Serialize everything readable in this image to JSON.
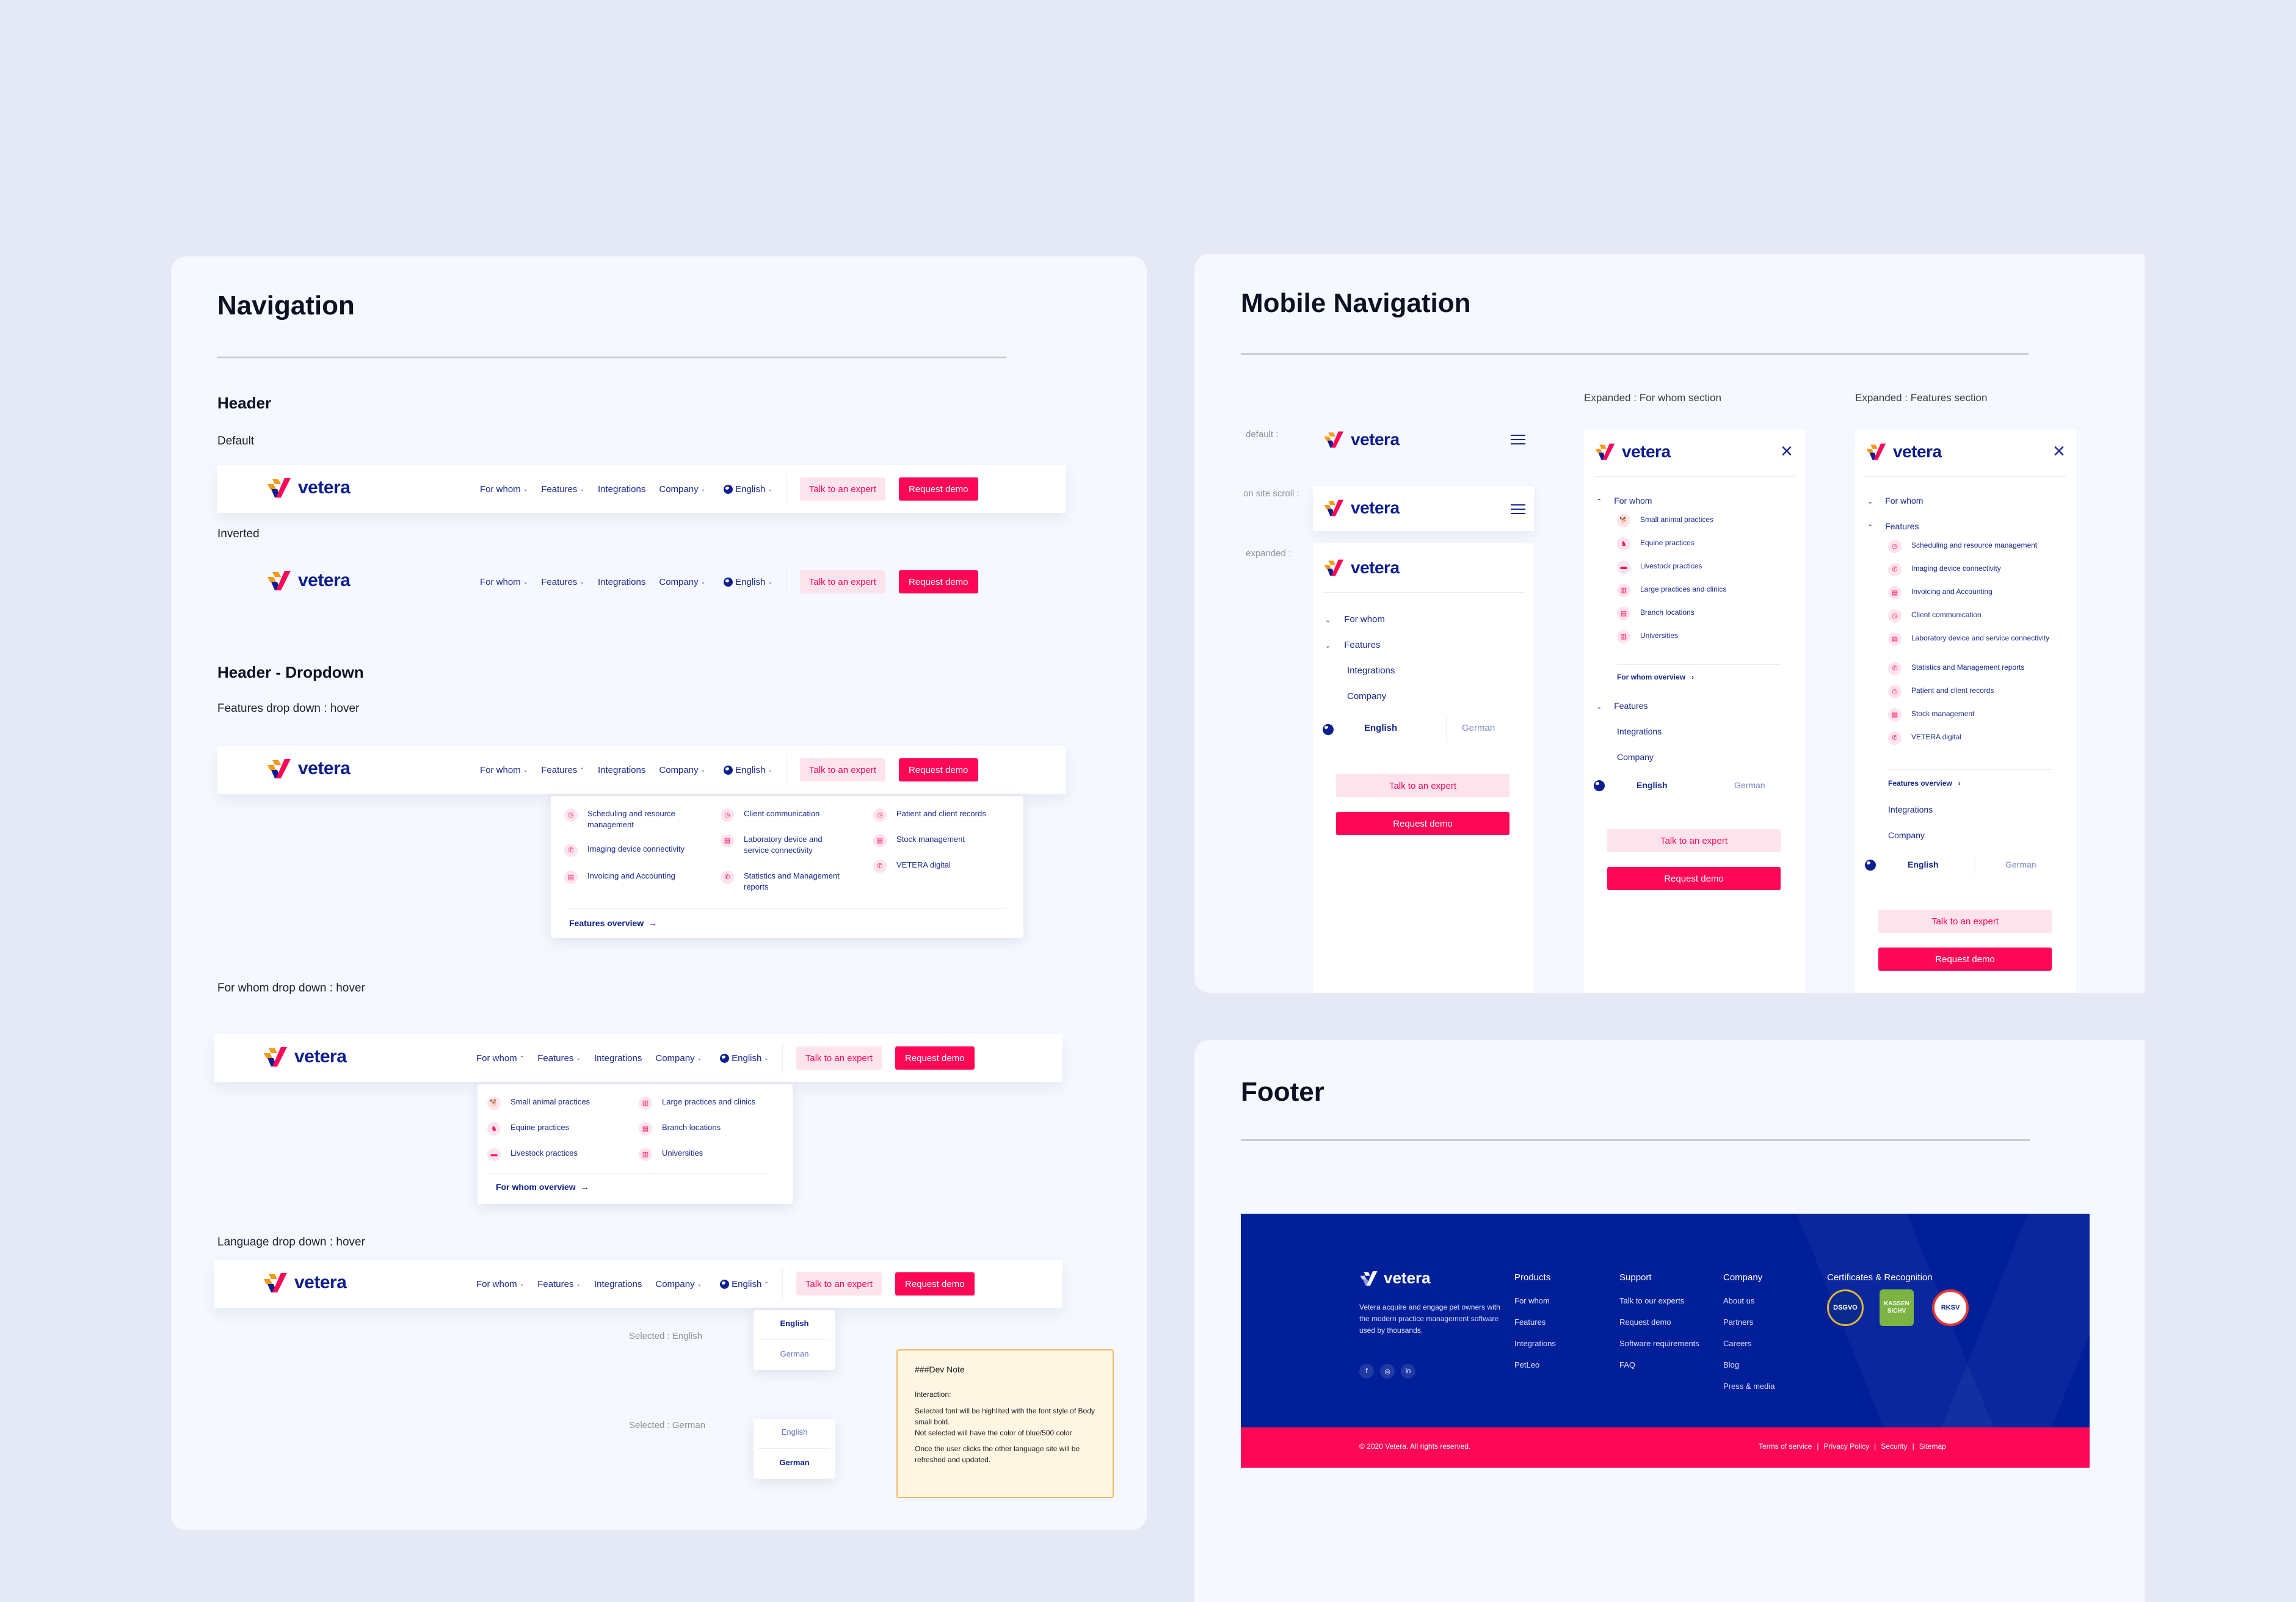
{
  "brand": {
    "name": "vetera",
    "colors": {
      "primary": "#0d1f8f",
      "accent": "#ff0757",
      "accent_soft": "#fde4ec",
      "footer_bg": "#001f99"
    }
  },
  "navigation": {
    "title": "Navigation",
    "header_section": "Header",
    "default_label": "Default",
    "inverted_label": "Inverted",
    "dropdown_section": "Header - Dropdown",
    "features_hover_label": "Features drop down : hover",
    "forwhom_hover_label": "For whom drop down : hover",
    "language_hover_label": "Language drop down : hover",
    "nav_items": [
      {
        "label": "For whom",
        "has_dropdown": true
      },
      {
        "label": "Features",
        "has_dropdown": true
      },
      {
        "label": "Integrations",
        "has_dropdown": false
      },
      {
        "label": "Company",
        "has_dropdown": true
      }
    ],
    "language": "English",
    "talk_label": "Talk to an expert",
    "demo_label": "Request demo",
    "features_menu": {
      "columns": [
        [
          {
            "icon": "clock-icon",
            "label": "Scheduling and resource management"
          },
          {
            "icon": "phone-icon",
            "label": "Imaging device connectivity"
          },
          {
            "icon": "document-icon",
            "label": "Invoicing and Accounting"
          }
        ],
        [
          {
            "icon": "clock-icon",
            "label": "Client communication"
          },
          {
            "icon": "document-icon",
            "label": "Laboratory device and service connectivity"
          },
          {
            "icon": "phone-icon",
            "label": "Statistics and Management reports"
          }
        ],
        [
          {
            "icon": "clock-icon",
            "label": "Patient and client records"
          },
          {
            "icon": "document-icon",
            "label": "Stock management"
          },
          {
            "icon": "phone-icon",
            "label": "VETERA digital"
          }
        ]
      ],
      "overview": "Features overview",
      "arrow": "→"
    },
    "forwhom_menu": {
      "columns": [
        [
          {
            "icon": "dog-icon",
            "label": "Small animal practices"
          },
          {
            "icon": "horse-icon",
            "label": "Equine practices"
          },
          {
            "icon": "pig-icon",
            "label": "Livestock practices"
          }
        ],
        [
          {
            "icon": "building-icon",
            "label": "Large practices and clinics"
          },
          {
            "icon": "document-icon",
            "label": "Branch locations"
          },
          {
            "icon": "building-icon",
            "label": "Universities"
          }
        ]
      ],
      "overview": "For whom overview",
      "arrow": "→"
    },
    "language_menu": {
      "selected_english_label": "Selected : English",
      "selected_german_label": "Selected : German",
      "options": [
        "English",
        "German"
      ]
    },
    "dev_note": {
      "title": "###Dev Note",
      "heading": "Interaction:",
      "line1": "Selected font will be highlited with the font style of Body small bold.",
      "line2": "Not selected will have the color of blue/500 color",
      "line3": "Once the user clicks the  other language site will be refreshed and updated."
    }
  },
  "mobile": {
    "title": "Mobile Navigation",
    "state_default": "default :",
    "state_scroll": "on site scroll :",
    "state_expanded": "expanded :",
    "forwhom_section_label": "Expanded  : For whom section",
    "features_section_label": "Expanded  : Features section",
    "items": [
      "For whom",
      "Features",
      "Integrations",
      "Company"
    ],
    "lang_english": "English",
    "lang_german": "German",
    "talk_label": "Talk to an expert",
    "demo_label": "Request demo",
    "forwhom_items": [
      "Small animal practices",
      "Equine practices",
      "Livestock practices",
      "Large practices and clinics",
      "Branch locations",
      "Universities"
    ],
    "forwhom_overview": "For whom overview",
    "features_items": [
      "Scheduling and resource management",
      "Imaging device connectivity",
      "Invoicing and Accounting",
      "Client communication",
      "Laboratory device and service connectivity",
      "Statistics and Management reports",
      "Patient and client records",
      "Stock management",
      "VETERA digital"
    ],
    "features_overview": "Features overview",
    "chevron_right": "›",
    "close": "×"
  },
  "footer": {
    "title": "Footer",
    "description": "Vetera acquire and engage pet owners with the modern practice management software used by thousands.",
    "columns": [
      {
        "title": "Products",
        "links": [
          "For whom",
          "Features",
          "Integrations",
          "PetLeo"
        ]
      },
      {
        "title": "Support",
        "links": [
          "Talk to our experts",
          "Request demo",
          "Software requirements",
          "FAQ"
        ]
      },
      {
        "title": "Company",
        "links": [
          "About us",
          "Partners",
          "Careers",
          "Blog",
          "Press & media"
        ]
      }
    ],
    "certificates_title": "Certificates & Recognition",
    "certificates": [
      "DSGVO",
      "KASSEN SICHV",
      "RKSV"
    ],
    "social": [
      "f",
      "◎",
      "in"
    ],
    "copyright": "© 2020 Vetera. All rights reserved.",
    "legal_links": [
      "Terms of service",
      "Privacy Policy",
      "Security",
      "Sitemap"
    ],
    "separator": "|"
  }
}
